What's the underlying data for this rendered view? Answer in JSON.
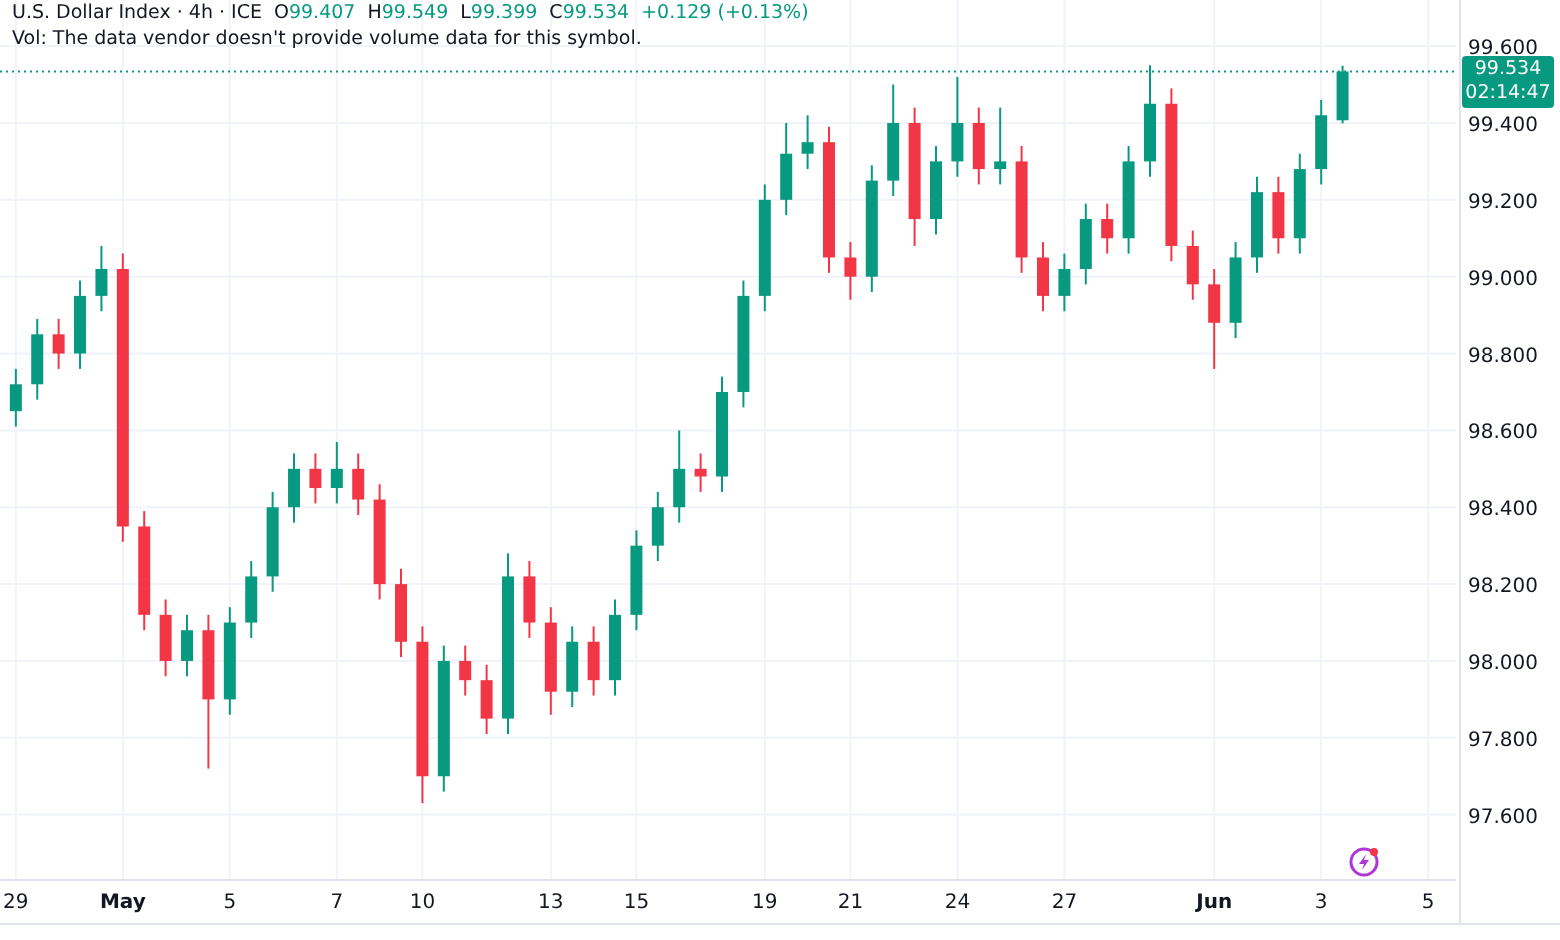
{
  "legend": {
    "symbol": "U.S. Dollar Index · 4h · ICE",
    "ohlc": [
      {
        "label": "O",
        "value": "99.407"
      },
      {
        "label": "H",
        "value": "99.549"
      },
      {
        "label": "L",
        "value": "99.399"
      },
      {
        "label": "C",
        "value": "99.534"
      }
    ],
    "change": "+0.129 (+0.13%)",
    "volume_note": "Vol: The data vendor doesn't provide volume data for this symbol."
  },
  "price_tag": {
    "countdown": "02:14:47"
  },
  "chart_data": {
    "type": "candlestick",
    "ylim": [
      97.43,
      99.72
    ],
    "grid": true,
    "ref_lines": [
      {
        "axis": "y",
        "value": 99.534,
        "label": "99.534",
        "color": "#089981"
      }
    ],
    "yticks": [
      {
        "value": 97.6,
        "label": "97.600"
      },
      {
        "value": 97.8,
        "label": "97.800"
      },
      {
        "value": 98.0,
        "label": "98.000"
      },
      {
        "value": 98.2,
        "label": "98.200"
      },
      {
        "value": 98.4,
        "label": "98.400"
      },
      {
        "value": 98.6,
        "label": "98.600"
      },
      {
        "value": 98.8,
        "label": "98.800"
      },
      {
        "value": 99.0,
        "label": "99.000"
      },
      {
        "value": 99.2,
        "label": "99.200"
      },
      {
        "value": 99.4,
        "label": "99.400"
      },
      {
        "value": 99.6,
        "label": "99.600"
      }
    ],
    "categories": [
      "29",
      null,
      null,
      null,
      null,
      "May",
      null,
      null,
      null,
      null,
      "5",
      null,
      null,
      null,
      null,
      "7",
      null,
      null,
      null,
      "10",
      null,
      null,
      null,
      null,
      null,
      "13",
      null,
      null,
      null,
      "15",
      null,
      null,
      null,
      null,
      null,
      "19",
      null,
      null,
      null,
      "21",
      null,
      null,
      null,
      null,
      "24",
      null,
      null,
      null,
      null,
      "27",
      null,
      null,
      null,
      null,
      null,
      null,
      "Jun",
      null,
      null,
      null,
      null,
      "3",
      null,
      null,
      null,
      null,
      "5"
    ],
    "ohlc": [
      [
        98.65,
        98.76,
        98.61,
        98.72
      ],
      [
        98.72,
        98.89,
        98.68,
        98.85
      ],
      [
        98.85,
        98.89,
        98.76,
        98.8
      ],
      [
        98.8,
        98.99,
        98.76,
        98.95
      ],
      [
        98.95,
        99.08,
        98.91,
        99.02
      ],
      [
        99.02,
        99.06,
        98.31,
        98.35
      ],
      [
        98.35,
        98.39,
        98.08,
        98.12
      ],
      [
        98.12,
        98.16,
        97.96,
        98.0
      ],
      [
        98.0,
        98.12,
        97.96,
        98.08
      ],
      [
        98.08,
        98.12,
        97.72,
        97.9
      ],
      [
        97.9,
        98.14,
        97.86,
        98.1
      ],
      [
        98.1,
        98.26,
        98.06,
        98.22
      ],
      [
        98.22,
        98.44,
        98.18,
        98.4
      ],
      [
        98.4,
        98.54,
        98.36,
        98.5
      ],
      [
        98.5,
        98.54,
        98.41,
        98.45
      ],
      [
        98.45,
        98.57,
        98.41,
        98.5
      ],
      [
        98.5,
        98.54,
        98.38,
        98.42
      ],
      [
        98.42,
        98.46,
        98.16,
        98.2
      ],
      [
        98.2,
        98.24,
        98.01,
        98.05
      ],
      [
        98.05,
        98.09,
        97.63,
        97.7
      ],
      [
        97.7,
        98.04,
        97.66,
        98.0
      ],
      [
        98.0,
        98.04,
        97.91,
        97.95
      ],
      [
        97.95,
        97.99,
        97.81,
        97.85
      ],
      [
        97.85,
        98.28,
        97.81,
        98.22
      ],
      [
        98.22,
        98.26,
        98.06,
        98.1
      ],
      [
        98.1,
        98.14,
        97.86,
        97.92
      ],
      [
        97.92,
        98.09,
        97.88,
        98.05
      ],
      [
        98.05,
        98.09,
        97.91,
        97.95
      ],
      [
        97.95,
        98.16,
        97.91,
        98.12
      ],
      [
        98.12,
        98.34,
        98.08,
        98.3
      ],
      [
        98.3,
        98.44,
        98.26,
        98.4
      ],
      [
        98.4,
        98.6,
        98.36,
        98.5
      ],
      [
        98.5,
        98.54,
        98.44,
        98.48
      ],
      [
        98.48,
        98.74,
        98.44,
        98.7
      ],
      [
        98.7,
        98.99,
        98.66,
        98.95
      ],
      [
        98.95,
        99.24,
        98.91,
        99.2
      ],
      [
        99.2,
        99.4,
        99.16,
        99.32
      ],
      [
        99.32,
        99.42,
        99.28,
        99.35
      ],
      [
        99.35,
        99.39,
        99.01,
        99.05
      ],
      [
        99.05,
        99.09,
        98.94,
        99.0
      ],
      [
        99.0,
        99.29,
        98.96,
        99.25
      ],
      [
        99.25,
        99.5,
        99.21,
        99.4
      ],
      [
        99.4,
        99.44,
        99.08,
        99.15
      ],
      [
        99.15,
        99.34,
        99.11,
        99.3
      ],
      [
        99.3,
        99.52,
        99.26,
        99.4
      ],
      [
        99.4,
        99.44,
        99.24,
        99.28
      ],
      [
        99.28,
        99.44,
        99.24,
        99.3
      ],
      [
        99.3,
        99.34,
        99.01,
        99.05
      ],
      [
        99.05,
        99.09,
        98.91,
        98.95
      ],
      [
        98.95,
        99.06,
        98.91,
        99.02
      ],
      [
        99.02,
        99.19,
        98.98,
        99.15
      ],
      [
        99.15,
        99.19,
        99.06,
        99.1
      ],
      [
        99.1,
        99.34,
        99.06,
        99.3
      ],
      [
        99.3,
        99.55,
        99.26,
        99.45
      ],
      [
        99.45,
        99.49,
        99.04,
        99.08
      ],
      [
        99.08,
        99.12,
        98.94,
        98.98
      ],
      [
        98.98,
        99.02,
        98.76,
        98.88
      ],
      [
        98.88,
        99.09,
        98.84,
        99.05
      ],
      [
        99.05,
        99.26,
        99.01,
        99.22
      ],
      [
        99.22,
        99.26,
        99.06,
        99.1
      ],
      [
        99.1,
        99.32,
        99.06,
        99.28
      ],
      [
        99.28,
        99.46,
        99.24,
        99.42
      ],
      [
        99.407,
        99.549,
        99.399,
        99.534
      ],
      null,
      null,
      null,
      null
    ]
  }
}
